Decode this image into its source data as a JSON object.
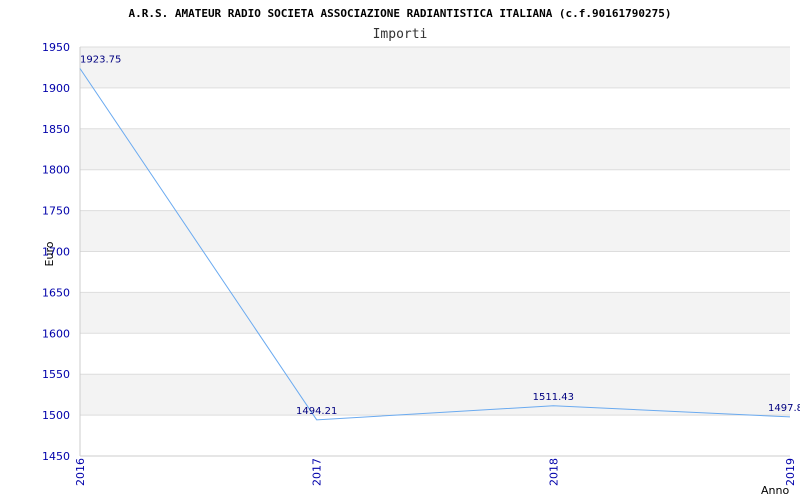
{
  "chart_data": {
    "type": "line",
    "title": "A.R.S. AMATEUR RADIO SOCIETA ASSOCIAZIONE RADIANTISTICA ITALIANA (c.f.90161790275)",
    "subtitle": "Importi",
    "xlabel": "Anno",
    "ylabel": "Euro",
    "categories": [
      "2016",
      "2017",
      "2018",
      "2019"
    ],
    "series": [
      {
        "values": [
          1923.75,
          1494.21,
          1511.43,
          1497.8
        ]
      }
    ],
    "data_labels": [
      "1923.75",
      "1494.21",
      "1511.43",
      "1497.8"
    ],
    "ylim": [
      1450,
      1950
    ],
    "yticks": [
      1450,
      1500,
      1550,
      1600,
      1650,
      1700,
      1750,
      1800,
      1850,
      1900,
      1950
    ],
    "grid": true,
    "colors": {
      "line": "#6aaaf0",
      "tick_text": "#0000aa",
      "band_alt": "#f3f3f3",
      "grid": "#dddddd"
    }
  }
}
